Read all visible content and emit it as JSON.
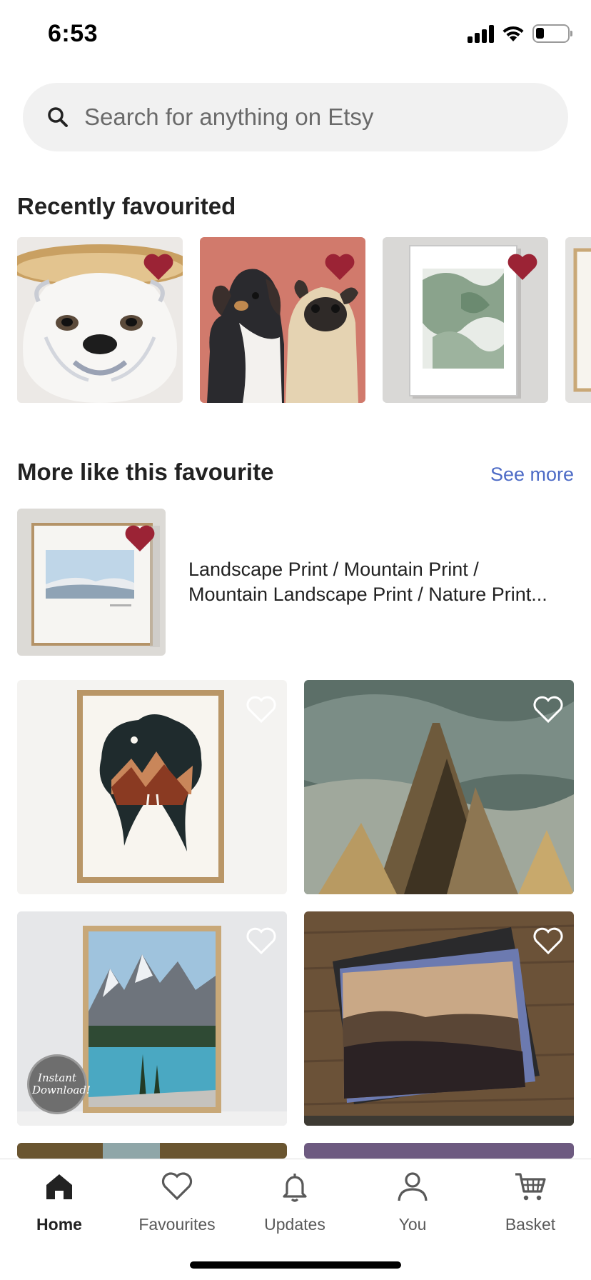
{
  "status_bar": {
    "time": "6:53"
  },
  "search": {
    "placeholder": "Search for anything on Etsy"
  },
  "recently_favourited": {
    "title": "Recently favourited",
    "items": [
      {
        "image": "bulldog-ceramic-dish",
        "favourited": true
      },
      {
        "image": "dachshund-and-pug-portrait",
        "favourited": true
      },
      {
        "image": "green-abstract-framed-print",
        "favourited": true
      },
      {
        "image": "framed-print-partial",
        "favourited": false
      }
    ]
  },
  "more_like": {
    "title": "More like this favourite",
    "see_more": "See more",
    "feature": {
      "title_line1": "Landscape Print / Mountain Print /",
      "title_line2": "Mountain Landscape Print / Nature Print...",
      "favourited": true
    },
    "grid": [
      {
        "image": "mountain-silhouette-framed-print",
        "favourited": false
      },
      {
        "image": "misty-forest-photo",
        "favourited": false
      },
      {
        "image": "moraine-lake-framed-print",
        "favourited": false,
        "badge": "Instant Download!"
      },
      {
        "image": "mountain-sunset-photo-prints",
        "favourited": false
      }
    ]
  },
  "bottom_nav": {
    "items": [
      {
        "label": "Home",
        "icon": "home-icon",
        "active": true
      },
      {
        "label": "Favourites",
        "icon": "heart-icon",
        "active": false
      },
      {
        "label": "Updates",
        "icon": "bell-icon",
        "active": false
      },
      {
        "label": "You",
        "icon": "person-icon",
        "active": false
      },
      {
        "label": "Basket",
        "icon": "cart-icon",
        "active": false
      }
    ]
  },
  "colors": {
    "favourite_red": "#9b2335",
    "link_blue": "#4d6bc6",
    "search_bg": "#f1f1f1"
  }
}
